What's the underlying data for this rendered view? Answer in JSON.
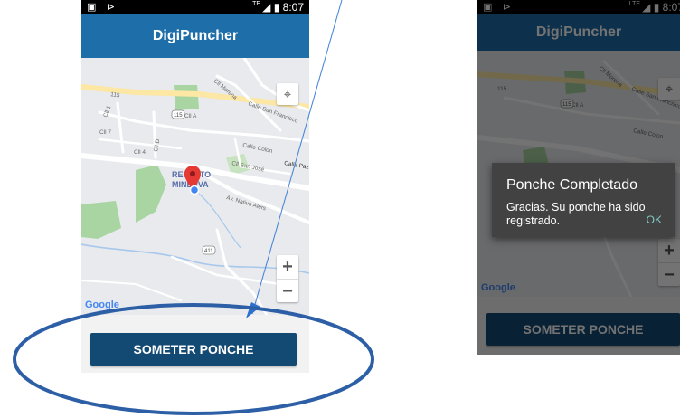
{
  "status_bar": {
    "lte": "LTE",
    "time": "8:07"
  },
  "app": {
    "title": "DigiPuncher"
  },
  "map": {
    "labels": {
      "calle_san_francisco": "Calle San Francisco",
      "cll_morena": "Cll Morena",
      "calle_colon": "Calle Colon",
      "cll_san_jose": "Cll San José",
      "calle_paz": "Calle Paz",
      "cll_a": "Cll A",
      "cll_d": "Cll D",
      "cll_4": "Cll 4",
      "cll_7": "Cll 7",
      "cll_1": "Cll 1",
      "av_nativo_alers": "Av. Nativo Alers",
      "reparto_minerva_1": "REPARTO",
      "reparto_minerva_2": "MINERVA",
      "route_115": "115",
      "route_115_shield": "115",
      "route_411": "411"
    },
    "google": "Google",
    "zoom_in": "+",
    "zoom_out": "−"
  },
  "button": {
    "submit_label": "SOMETER PONCHE"
  },
  "dialog": {
    "title": "Ponche Completado",
    "message": "Gracias.  Su ponche ha sido registrado.",
    "ok_label": "OK"
  },
  "colors": {
    "appbar": "#1e6ea9",
    "button": "#134a74",
    "annotation": "#2d5fa6"
  }
}
